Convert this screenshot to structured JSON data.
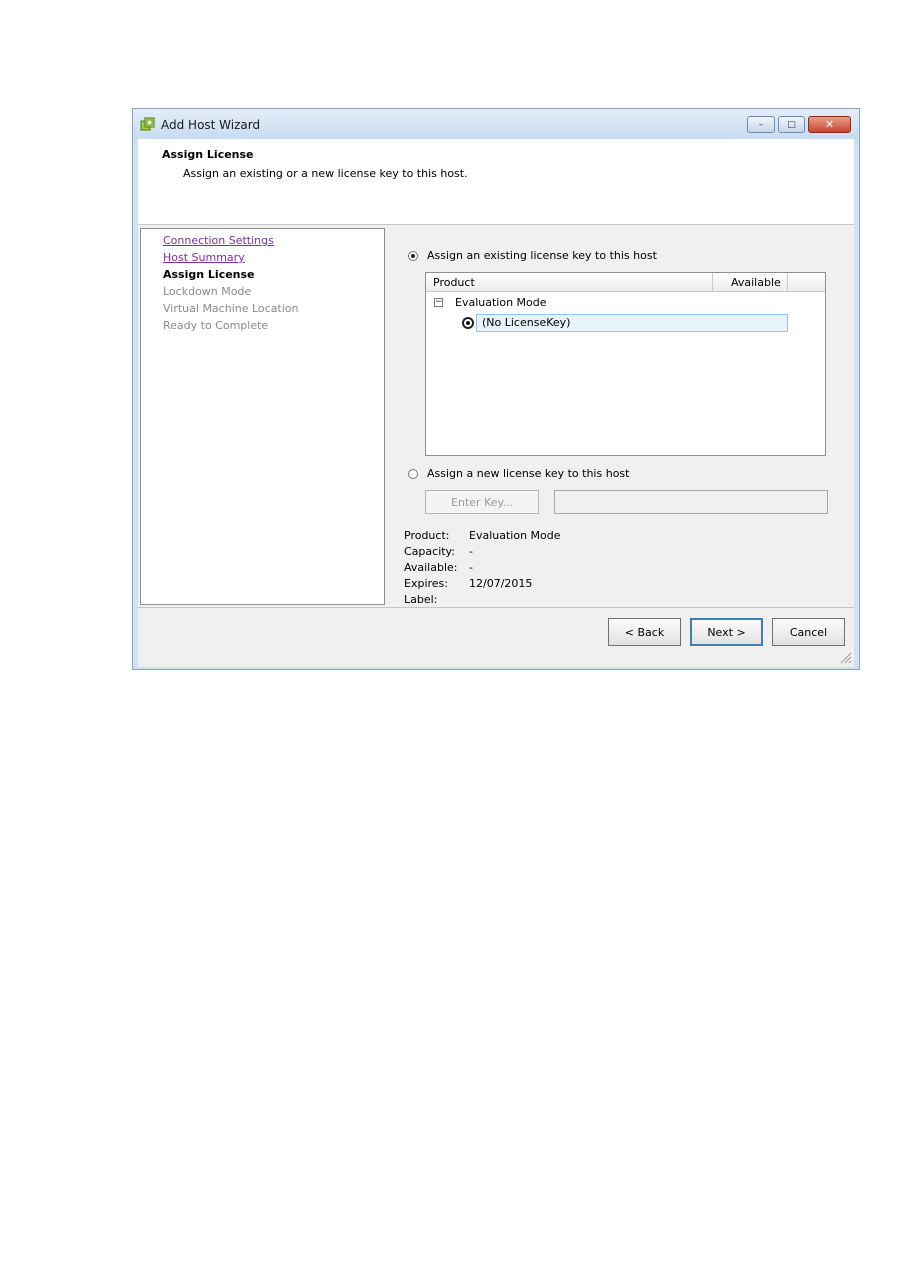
{
  "window": {
    "title": "Add Host Wizard",
    "app_icon": "vsphere-host-icon",
    "controls": {
      "minimize": "–",
      "maximize": "□",
      "close": "✕"
    }
  },
  "header": {
    "title": "Assign License",
    "subtitle": "Assign an existing or a new license key to this host."
  },
  "steps": [
    {
      "label": "Connection Settings",
      "state": "completed"
    },
    {
      "label": "Host Summary",
      "state": "completed"
    },
    {
      "label": "Assign License",
      "state": "current"
    },
    {
      "label": "Lockdown Mode",
      "state": "pending"
    },
    {
      "label": "Virtual Machine Location",
      "state": "pending"
    },
    {
      "label": "Ready to Complete",
      "state": "pending"
    }
  ],
  "options": {
    "existing": {
      "label": "Assign an existing license key to this host",
      "selected": true
    },
    "new": {
      "label": "Assign a new license key to this host",
      "selected": false
    }
  },
  "grid": {
    "columns": [
      "Product",
      "Available"
    ],
    "group": "Evaluation Mode",
    "group_toggle": "−",
    "rows": [
      {
        "label": "(No LicenseKey)",
        "selected": true
      }
    ]
  },
  "new_key": {
    "button_label": "Enter Key...",
    "value": ""
  },
  "info": [
    {
      "label": "Product:",
      "value": "Evaluation Mode"
    },
    {
      "label": "Capacity:",
      "value": "-"
    },
    {
      "label": "Available:",
      "value": "-"
    },
    {
      "label": "Expires:",
      "value": "12/07/2015"
    },
    {
      "label": "Label:",
      "value": ""
    }
  ],
  "buttons": {
    "back": "< Back",
    "next": "Next >",
    "cancel": "Cancel"
  }
}
